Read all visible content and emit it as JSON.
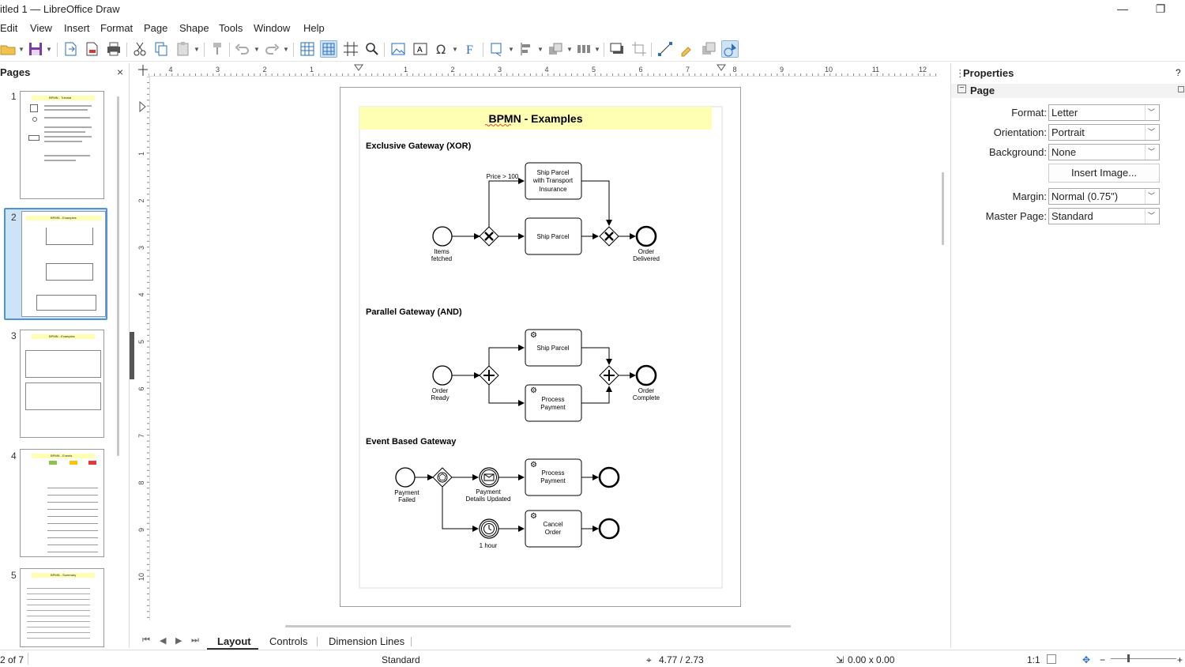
{
  "window": {
    "title": "itled 1 — LibreOffice Draw",
    "minimize_glyph": "—",
    "restore_glyph": "❐"
  },
  "menu": [
    "Edit",
    "View",
    "Insert",
    "Format",
    "Page",
    "Shape",
    "Tools",
    "Window",
    "Help"
  ],
  "pages_pane": {
    "header": "Pages",
    "close_glyph": "×",
    "pages": [
      {
        "num": "1",
        "title": "BPMN - Tutorial"
      },
      {
        "num": "2",
        "title": "BPMN - Examples",
        "selected": true
      },
      {
        "num": "3",
        "title": "BPMN - Examples"
      },
      {
        "num": "4",
        "title": "BPMN - Events"
      },
      {
        "num": "5",
        "title": "BPMN - Summary"
      }
    ]
  },
  "ruler": {
    "h_ticks": [
      "4",
      "3",
      "2",
      "1",
      "1",
      "2",
      "3",
      "4",
      "5",
      "6",
      "7",
      "8",
      "9",
      "10",
      "11",
      "12"
    ],
    "v_ticks": [
      "1",
      "2",
      "3",
      "4",
      "5",
      "6",
      "7",
      "8",
      "9",
      "10"
    ]
  },
  "diagram": {
    "title": "BPMN - Examples",
    "sections": {
      "xor": "Exclusive Gateway (XOR)",
      "and": "Parallel Gateway (AND)",
      "event": "Event Based Gateway"
    },
    "xor": {
      "condition": "Price > 100",
      "task_top": [
        "Ship Parcel",
        "with Transport",
        "Insurance"
      ],
      "task_bottom": "Ship Parcel",
      "start_label": [
        "Items",
        "fetched"
      ],
      "end_label": [
        "Order",
        "Delivered"
      ]
    },
    "and": {
      "task_top": "Ship Parcel",
      "task_bottom": [
        "Process",
        "Payment"
      ],
      "start_label": [
        "Order",
        "Ready"
      ],
      "end_label": [
        "Order",
        "Complete"
      ]
    },
    "event": {
      "start_label": [
        "Payment",
        "Failed"
      ],
      "msg_label": [
        "Payment",
        "Details Updated"
      ],
      "timer_label": "1 hour",
      "task_top": [
        "Process",
        "Payment"
      ],
      "task_bottom": [
        "Cancel",
        "Order"
      ]
    }
  },
  "properties": {
    "header": "Properties",
    "help_glyph": "?",
    "section": "Page",
    "rows": [
      {
        "label": "Format:",
        "value": "Letter"
      },
      {
        "label": "Orientation:",
        "value": "Portrait"
      },
      {
        "label": "Background:",
        "value": "None"
      },
      {
        "label": "Margin:",
        "value": "Normal (0.75\")"
      },
      {
        "label": "Master Page:",
        "value": "Standard"
      }
    ],
    "insert_image": "Insert Image..."
  },
  "tabs": [
    "Layout",
    "Controls",
    "Dimension Lines"
  ],
  "status": {
    "page": "2 of 7",
    "master": "Standard",
    "position": "4.77 / 2.73",
    "size": "0.00 x 0.00",
    "ratio": "1:1"
  },
  "colors": {
    "title_band": "#ffffb3",
    "selection": "#4d94d8",
    "accent_blue": "#2a6ebd",
    "save_purple": "#7a3aa8"
  }
}
